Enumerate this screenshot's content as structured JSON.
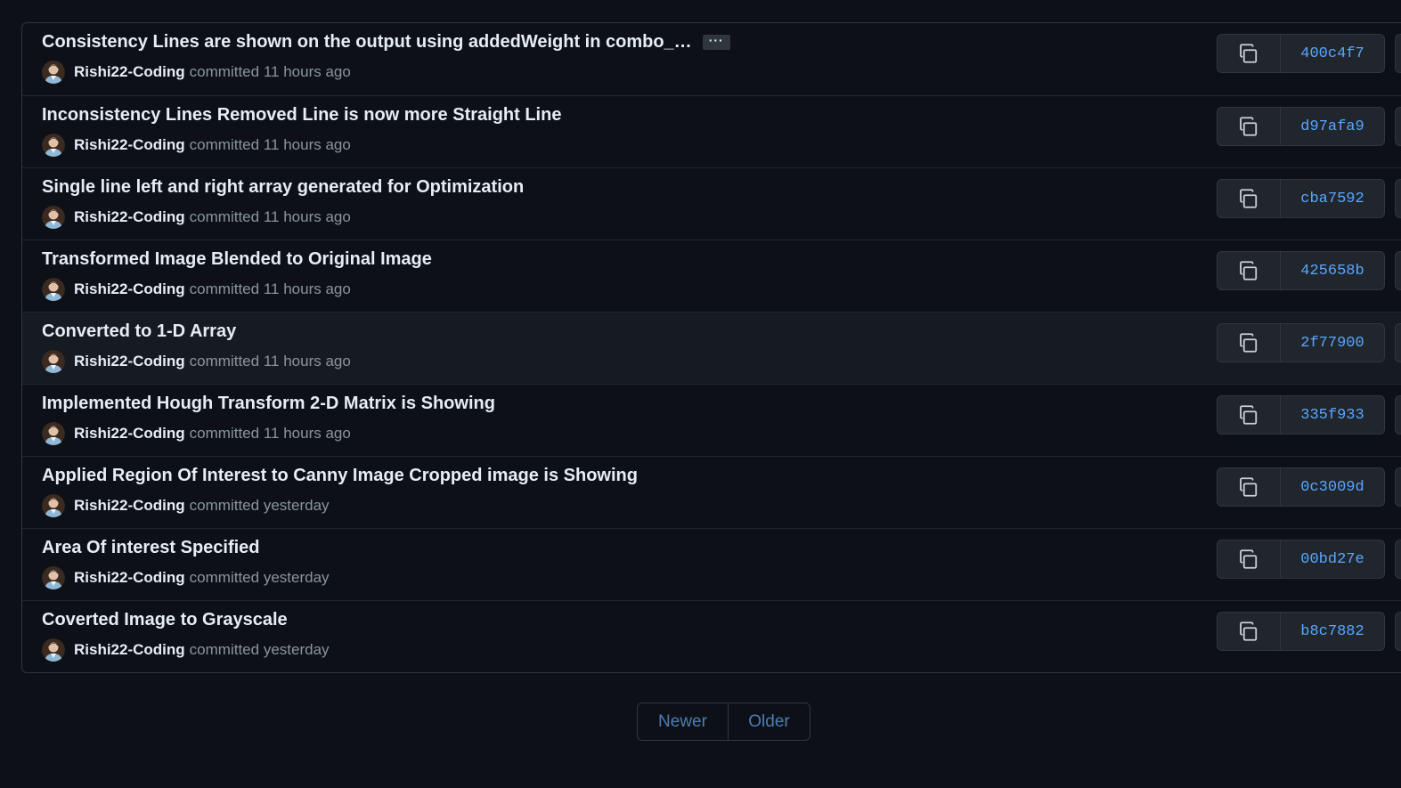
{
  "commits": [
    {
      "title": "Consistency Lines are shown on the output using addedWeight in combo_…",
      "has_more": true,
      "more_label": "···",
      "author": "Rishi22-Coding",
      "action": "committed",
      "time": "11 hours ago",
      "sha": "400c4f7",
      "hovered": false
    },
    {
      "title": "Inconsistency Lines Removed Line is now more Straight Line",
      "has_more": false,
      "author": "Rishi22-Coding",
      "action": "committed",
      "time": "11 hours ago",
      "sha": "d97afa9",
      "hovered": false
    },
    {
      "title": "Single line left and right array generated for Optimization",
      "has_more": false,
      "author": "Rishi22-Coding",
      "action": "committed",
      "time": "11 hours ago",
      "sha": "cba7592",
      "hovered": false
    },
    {
      "title": "Transformed Image Blended to Original Image",
      "has_more": false,
      "author": "Rishi22-Coding",
      "action": "committed",
      "time": "11 hours ago",
      "sha": "425658b",
      "hovered": false
    },
    {
      "title": "Converted to 1-D Array",
      "has_more": false,
      "author": "Rishi22-Coding",
      "action": "committed",
      "time": "11 hours ago",
      "sha": "2f77900",
      "hovered": true
    },
    {
      "title": "Implemented Hough Transform 2-D Matrix is Showing",
      "has_more": false,
      "author": "Rishi22-Coding",
      "action": "committed",
      "time": "11 hours ago",
      "sha": "335f933",
      "hovered": false
    },
    {
      "title": "Applied Region Of Interest to Canny Image Cropped image is Showing",
      "has_more": false,
      "author": "Rishi22-Coding",
      "action": "committed",
      "time": "yesterday",
      "sha": "0c3009d",
      "hovered": false
    },
    {
      "title": "Area Of interest Specified",
      "has_more": false,
      "author": "Rishi22-Coding",
      "action": "committed",
      "time": "yesterday",
      "sha": "00bd27e",
      "hovered": false
    },
    {
      "title": "Coverted Image to Grayscale",
      "has_more": false,
      "author": "Rishi22-Coding",
      "action": "committed",
      "time": "yesterday",
      "sha": "b8c7882",
      "hovered": false
    }
  ],
  "pagination": {
    "newer_label": "Newer",
    "older_label": "Older"
  },
  "icons": {
    "copy": "copy-icon",
    "avatar": "avatar"
  },
  "colors": {
    "background": "#0d1117",
    "link": "#58a6ff",
    "border": "#30363d"
  }
}
